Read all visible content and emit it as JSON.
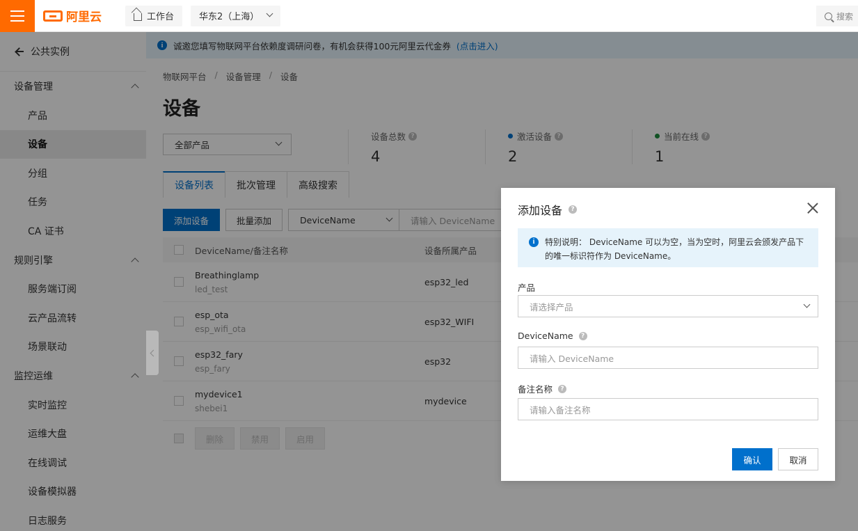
{
  "topbar": {
    "logo_text": "阿里云",
    "workbench_label": "工作台",
    "region_label": "华东2（上海）",
    "search_placeholder": "搜索"
  },
  "sidebar": {
    "back_label": "公共实例",
    "groups": [
      {
        "label": "设备管理",
        "items": [
          "产品",
          "设备",
          "分组",
          "任务",
          "CA 证书"
        ]
      },
      {
        "label": "规则引擎",
        "items": [
          "服务端订阅",
          "云产品流转",
          "场景联动"
        ]
      },
      {
        "label": "监控运维",
        "items": [
          "实时监控",
          "运维大盘",
          "在线调试",
          "设备模拟器",
          "日志服务"
        ]
      }
    ],
    "active_item": "设备"
  },
  "notice": {
    "text": "诚邀您填写物联网平台依赖度调研问卷，有机会获得100元阿里云代金券",
    "link": "(点击进入)"
  },
  "breadcrumb": [
    "物联网平台",
    "设备管理",
    "设备"
  ],
  "page_title": "设备",
  "product_filter": "全部产品",
  "stats": [
    {
      "label": "设备总数",
      "value": "4",
      "dot": ""
    },
    {
      "label": "激活设备",
      "value": "2",
      "dot": "#0070cc"
    },
    {
      "label": "当前在线",
      "value": "1",
      "dot": "#1e8e3e"
    }
  ],
  "tabs": [
    "设备列表",
    "批次管理",
    "高级搜索"
  ],
  "toolbar": {
    "add_label": "添加设备",
    "batch_label": "批量添加",
    "field_select": "DeviceName",
    "search_placeholder": "请输入 DeviceName"
  },
  "table": {
    "headers": [
      "DeviceName/备注名称",
      "设备所属产品"
    ],
    "rows": [
      {
        "name": "Breathinglamp",
        "note": "led_test",
        "product": "esp32_led"
      },
      {
        "name": "esp_ota",
        "note": "esp_wifi_ota",
        "product": "esp32_WIFI"
      },
      {
        "name": "esp32_fary",
        "note": "esp_fary",
        "product": "esp32"
      },
      {
        "name": "mydevice1",
        "note": "shebei1",
        "product": "mydevice"
      }
    ],
    "bulk_actions": [
      "删除",
      "禁用",
      "启用"
    ]
  },
  "modal": {
    "title": "添加设备",
    "tip_prefix": "特别说明：",
    "tip_text": "DeviceName 可以为空，当为空时，阿里云会颁发产品下的唯一标识符作为 DeviceName。",
    "product_label": "产品",
    "product_placeholder": "请选择产品",
    "devicename_label": "DeviceName",
    "devicename_placeholder": "请输入 DeviceName",
    "note_label": "备注名称",
    "note_placeholder": "请输入备注名称",
    "ok_label": "确认",
    "cancel_label": "取消"
  }
}
